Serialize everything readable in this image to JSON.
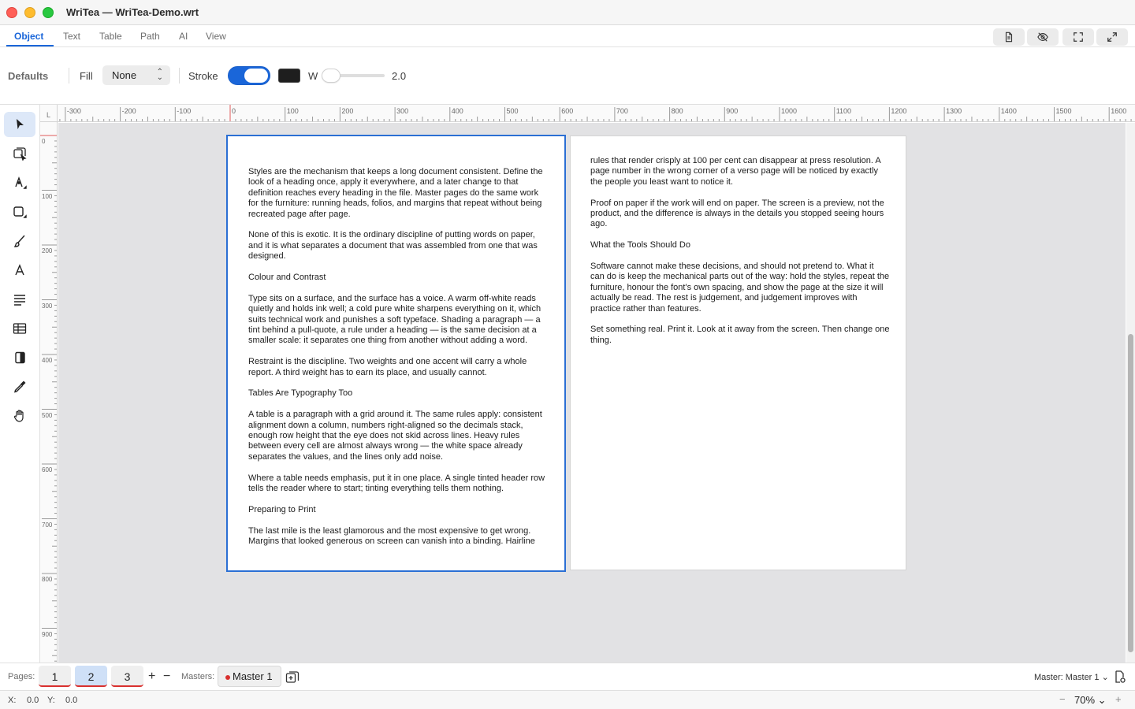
{
  "window": {
    "title": "WriTea — WriTea-Demo.wrt"
  },
  "tabs": [
    {
      "label": "Object",
      "active": true
    },
    {
      "label": "Text"
    },
    {
      "label": "Table"
    },
    {
      "label": "Path"
    },
    {
      "label": "AI"
    },
    {
      "label": "View"
    }
  ],
  "view_buttons": [
    "page-icon",
    "eye-slash-icon",
    "fullscreen-icon",
    "expand-icon"
  ],
  "properties": {
    "defaults_label": "Defaults",
    "fill_label": "Fill",
    "fill_value": "None",
    "stroke_label": "Stroke",
    "stroke_enabled": true,
    "stroke_color": "#1e1e1e",
    "width_label": "W",
    "width_value": "2.0",
    "width_fraction": 0.02
  },
  "tools": [
    {
      "name": "select-arrow-icon",
      "active": true
    },
    {
      "name": "node-select-icon"
    },
    {
      "name": "pen-tool-icon"
    },
    {
      "name": "rectangle-tool-icon"
    },
    {
      "name": "brush-icon"
    },
    {
      "name": "text-tool-icon"
    },
    {
      "name": "paragraph-icon"
    },
    {
      "name": "table-icon"
    },
    {
      "name": "contrast-icon"
    },
    {
      "name": "eyedropper-icon"
    },
    {
      "name": "hand-icon"
    }
  ],
  "ruler": {
    "horizontal": [
      "-300",
      "-200",
      "-100",
      "0",
      "100",
      "200",
      "300",
      "400",
      "500",
      "600",
      "700",
      "800",
      "900",
      "1000",
      "1100",
      "1200",
      "1300",
      "1400",
      "1500",
      "1600"
    ],
    "vertical": [
      "0",
      "100",
      "200",
      "300",
      "400",
      "500",
      "600",
      "700",
      "800",
      "900"
    ],
    "corner": "L"
  },
  "pages": {
    "left": [
      "Styles are the mechanism that keeps a long document consistent. Define the look of a heading once, apply it everywhere, and a later change to that definition reaches every heading in the file. Master pages do the same work for the furniture: running heads, folios, and margins that repeat without being recreated page after page.",
      "None of this is exotic. It is the ordinary discipline of putting words on paper, and it is what separates a document that was assembled from one that was designed.",
      "Colour and Contrast",
      "Type sits on a surface, and the surface has a voice. A warm off-white reads quietly and holds ink well; a cold pure white sharpens everything on it, which suits technical work and punishes a soft typeface. Shading a paragraph — a tint behind a pull-quote, a rule under a heading — is the same decision at a smaller scale: it separates one thing from another without adding a word.",
      "Restraint is the discipline. Two weights and one accent will carry a whole report. A third weight has to earn its place, and usually cannot.",
      "Tables Are Typography Too",
      "A table is a paragraph with a grid around it. The same rules apply: consistent alignment down a column, numbers right-aligned so the decimals stack, enough row height that the eye does not skid across lines. Heavy rules between every cell are almost always wrong — the white space already separates the values, and the lines only add noise.",
      "Where a table needs emphasis, put it in one place. A single tinted header row tells the reader where to start; tinting everything tells them nothing.",
      "Preparing to Print",
      "The last mile is the least glamorous and the most expensive to get wrong. Margins that looked generous on screen can vanish into a binding. Hairline"
    ],
    "right": [
      "rules that render crisply at 100 per cent can disappear at press resolution. A page number in the wrong corner of a verso page will be noticed by exactly the people you least want to notice it.",
      "Proof on paper if the work will end on paper. The screen is a preview, not the product, and the difference is always in the details you stopped seeing hours ago.",
      "What the Tools Should Do",
      "Software cannot make these decisions, and should not pretend to. What it can do is keep the mechanical parts out of the way: hold the styles, repeat the furniture, honour the font's own spacing, and show the page at the size it will actually be read. The rest is judgement, and judgement improves with practice rather than features.",
      "Set something real. Print it. Look at it away from the screen. Then change one thing."
    ]
  },
  "pages_bar": {
    "pages_label": "Pages:",
    "page_tabs": [
      {
        "label": "1"
      },
      {
        "label": "2",
        "active": true
      },
      {
        "label": "3"
      }
    ],
    "add_label": "+",
    "remove_label": "−",
    "masters_label": "Masters:",
    "master_tab": "Master 1",
    "master_select": "Master: Master 1"
  },
  "status": {
    "x_label": "X:",
    "x_value": "0.0",
    "y_label": "Y:",
    "y_value": "0.0",
    "zoom": "70%",
    "zoom_out": "−",
    "zoom_in": "+"
  },
  "colors": {
    "accent": "#1a66d9",
    "page_marker": "#d9302e"
  }
}
